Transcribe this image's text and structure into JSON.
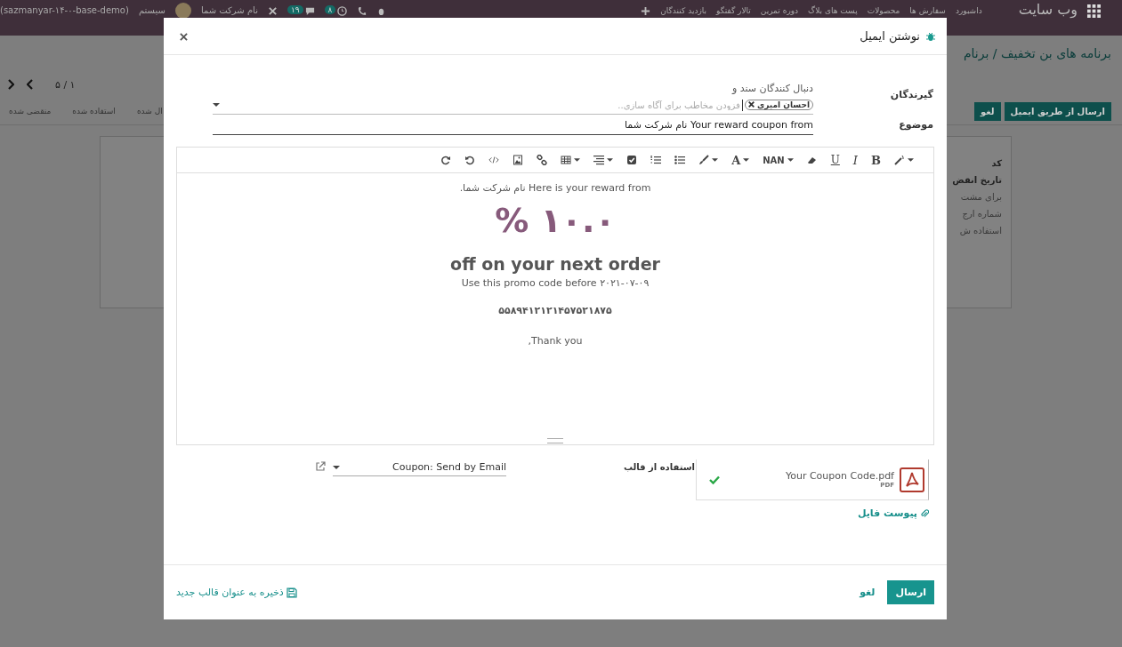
{
  "topbar": {
    "app_title": "وب سایت",
    "menu": [
      "داشبورد",
      "سفارش ها",
      "محصولات",
      "پست های بلاگ",
      "دوره تمرین",
      "تالار گفتگو",
      "بازدید کنندگان"
    ],
    "activity_count": "۸",
    "message_count": "۱۹",
    "company": "نام شرکت شما",
    "user": "سیستم",
    "database": "(sazmanyar-۱۴-۰-base-demo)"
  },
  "background": {
    "breadcrumb": "برنامه های بن تخفیف / برنام",
    "pager": "۵ / ۱",
    "buttons": [
      {
        "label": "ارسال از طریق ایمیل",
        "kind": "primary"
      },
      {
        "label": "لغو",
        "kind": "primary"
      }
    ],
    "status_steps": [
      "ال شده",
      "استفاده شده",
      "منقضی شده"
    ],
    "card_lines": [
      {
        "text": "کد",
        "bold": true
      },
      {
        "text": "تاریخ انقض",
        "bold": true
      },
      {
        "text": "برای مشت",
        "bold": false
      },
      {
        "text": "شماره ارج",
        "bold": false
      },
      {
        "text": "استفاده ش",
        "bold": false
      }
    ]
  },
  "dialog": {
    "title": "نوشتن ایمیل",
    "recipients": {
      "label": "گیرندگان",
      "followers_text": "دنبال کنندگان سند و",
      "tags": [
        "احسان امیری"
      ],
      "placeholder": "فزودن مخاطب برای آگاه سازی.."
    },
    "subject": {
      "label": "موضوع",
      "value": "Your reward coupon from نام شرکت شما"
    },
    "toolbar": {
      "bold": "B",
      "italic": "I",
      "underline": "U",
      "font_size": "NAN",
      "font_color": "A"
    },
    "body": [
      {
        "kind": "text",
        "text": "Here is your reward from نام شرکت شما."
      },
      {
        "kind": "amount",
        "text": "% ۱۰.۰"
      },
      {
        "kind": "heading",
        "text": "off on your next order"
      },
      {
        "kind": "text",
        "text": "Use this promo code before ۲۰۲۱-۰۷-۰۹"
      },
      {
        "kind": "code",
        "text": "۵۵۸۹۴۱۲۱۲۱۴۵۷۵۲۱۸۷۵"
      },
      {
        "kind": "text",
        "text": "Thank you,"
      }
    ],
    "attachment": {
      "name": "Your Coupon Code.pdf",
      "type": "PDF",
      "uploaded": true
    },
    "attach_link": "پیوست فایل",
    "template": {
      "label": "استفاده از قالب",
      "value": "Coupon: Send by Email"
    },
    "send_button": "ارسال",
    "cancel_button": "لغو",
    "save_template": "ذخیره به عنوان قالب جدید"
  }
}
